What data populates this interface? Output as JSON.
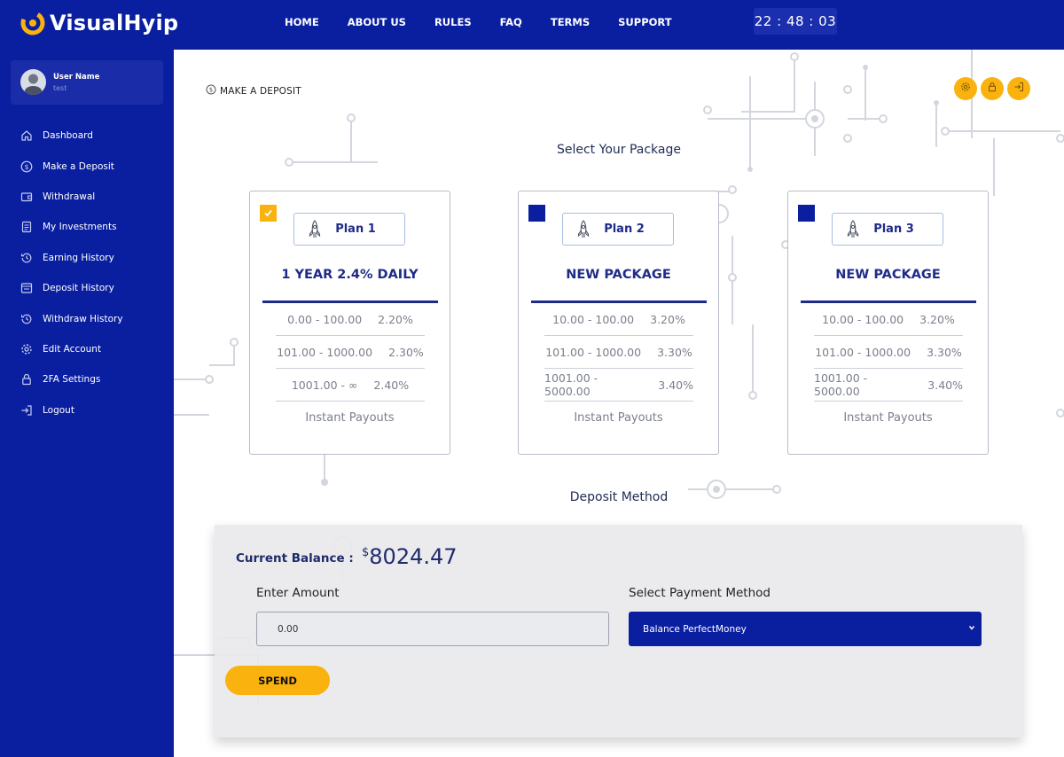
{
  "brand": {
    "name": "VisualHyip",
    "accent": "#fab20f",
    "primary": "#0a1fa0"
  },
  "topnav": {
    "items": [
      {
        "label": "HOME"
      },
      {
        "label": "ABOUT US"
      },
      {
        "label": "RULES"
      },
      {
        "label": "FAQ"
      },
      {
        "label": "TERMS"
      },
      {
        "label": "SUPPORT"
      }
    ],
    "clock": "22 : 48 : 03"
  },
  "user": {
    "name": "User Name",
    "username": "test"
  },
  "sidebar": {
    "items": [
      {
        "label": "Dashboard",
        "icon": "home-icon"
      },
      {
        "label": "Make a Deposit",
        "icon": "dollar-circle-icon"
      },
      {
        "label": "Withdrawal",
        "icon": "wallet-icon"
      },
      {
        "label": "My Investments",
        "icon": "document-icon"
      },
      {
        "label": "Earning History",
        "icon": "history-icon"
      },
      {
        "label": "Deposit History",
        "icon": "receipt-icon"
      },
      {
        "label": "Withdraw History",
        "icon": "history-icon"
      },
      {
        "label": "Edit Account",
        "icon": "gear-icon"
      },
      {
        "label": "2FA Settings",
        "icon": "lock-icon"
      },
      {
        "label": "Logout",
        "icon": "logout-icon"
      }
    ]
  },
  "page": {
    "breadcrumb": "MAKE A DEPOSIT",
    "breadcrumb_icon": "dollar-circle-icon",
    "actions": [
      {
        "icon": "gear-icon"
      },
      {
        "icon": "lock-icon"
      },
      {
        "icon": "logout-icon"
      }
    ],
    "select_package_title": "Select Your Package",
    "deposit_method_title": "Deposit Method"
  },
  "plans": [
    {
      "name": "Plan 1",
      "title": "1 YEAR 2.4% DAILY",
      "selected": true,
      "tiers": [
        {
          "range": "0.00 - 100.00",
          "rate": "2.20%"
        },
        {
          "range": "101.00 - 1000.00",
          "rate": "2.30%"
        },
        {
          "range": "1001.00 - ∞",
          "rate": "2.40%"
        }
      ],
      "payout": "Instant Payouts"
    },
    {
      "name": "Plan 2",
      "title": "NEW PACKAGE",
      "selected": false,
      "tiers": [
        {
          "range": "10.00 - 100.00",
          "rate": "3.20%"
        },
        {
          "range": "101.00 - 1000.00",
          "rate": "3.30%"
        },
        {
          "range": "1001.00 - 5000.00",
          "rate": "3.40%"
        }
      ],
      "payout": "Instant Payouts"
    },
    {
      "name": "Plan 3",
      "title": "NEW PACKAGE",
      "selected": false,
      "tiers": [
        {
          "range": "10.00 - 100.00",
          "rate": "3.20%"
        },
        {
          "range": "101.00 - 1000.00",
          "rate": "3.30%"
        },
        {
          "range": "1001.00 - 5000.00",
          "rate": "3.40%"
        }
      ],
      "payout": "Instant Payouts"
    }
  ],
  "deposit": {
    "balance_label": "Current Balance :",
    "currency_symbol": "$",
    "balance_value": "8024.47",
    "amount_label": "Enter Amount",
    "amount_value": "0.00",
    "payment_label": "Select Payment Method",
    "payment_selected": "Balance PerfectMoney",
    "spend_label": "SPEND"
  }
}
